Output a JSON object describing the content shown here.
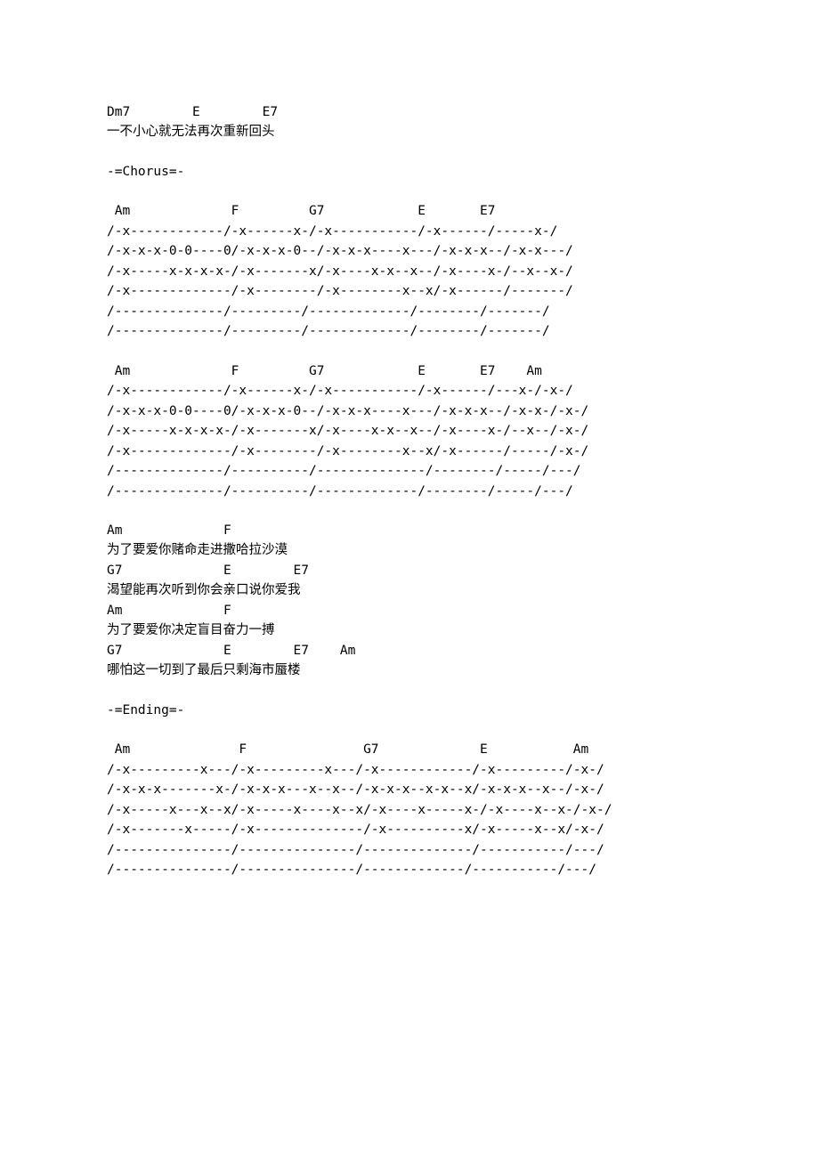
{
  "intro": {
    "chords": "Dm7        E        E7",
    "lyrics": "一不小心就无法再次重新回头"
  },
  "chorus_label": "-=Chorus=-",
  "tab1": {
    "l1": " Am             F         G7            E       E7",
    "l2": "/-x------------/-x------x-/-x-----------/-x------/-----x-/",
    "l3": "/-x-x-x-0-0----0/-x-x-x-0--/-x-x-x----x---/-x-x-x--/-x-x---/",
    "l4": "/-x-----x-x-x-x-/-x-------x/-x----x-x--x--/-x----x-/--x--x-/",
    "l5": "/-x-------------/-x--------/-x--------x--x/-x------/-------/",
    "l6": "/--------------/---------/-------------/--------/-------/",
    "l7": "/--------------/---------/-------------/--------/-------/"
  },
  "tab2": {
    "l1": " Am             F         G7            E       E7    Am",
    "l2": "/-x------------/-x------x-/-x-----------/-x------/---x-/-x-/",
    "l3": "/-x-x-x-0-0----0/-x-x-x-0--/-x-x-x----x---/-x-x-x--/-x-x-/-x-/",
    "l4": "/-x-----x-x-x-x-/-x-------x/-x----x-x--x--/-x----x-/--x--/-x-/",
    "l5": "/-x-------------/-x--------/-x--------x--x/-x------/-----/-x-/",
    "l6": "/--------------/----------/--------------/--------/-----/---/",
    "l7": "/--------------/----------/-------------/--------/-----/---/"
  },
  "verse": {
    "l1": "Am             F",
    "l2": "为了要爱你赌命走进撒哈拉沙漠",
    "l3": "G7             E        E7",
    "l4": "渴望能再次听到你会亲口说你爱我",
    "l5": "Am             F",
    "l6": "为了要爱你决定盲目奋力一搏",
    "l7": "G7             E        E7    Am",
    "l8": "哪怕这一切到了最后只剩海市蜃楼"
  },
  "ending_label": "-=Ending=-",
  "tab3": {
    "l1": " Am              F               G7             E           Am",
    "l2": "/-x---------x---/-x---------x---/-x------------/-x---------/-x-/",
    "l3": "/-x-x-x-------x-/-x-x-x---x--x--/-x-x-x--x-x--x/-x-x-x--x--/-x-/",
    "l4": "/-x-----x---x--x/-x-----x----x--x/-x----x-----x-/-x----x--x-/-x-/",
    "l5": "/-x-------x-----/-x--------------/-x----------x/-x-----x--x/-x-/",
    "l6": "/---------------/---------------/--------------/-----------/---/",
    "l7": "/---------------/---------------/-------------/-----------/---/"
  }
}
